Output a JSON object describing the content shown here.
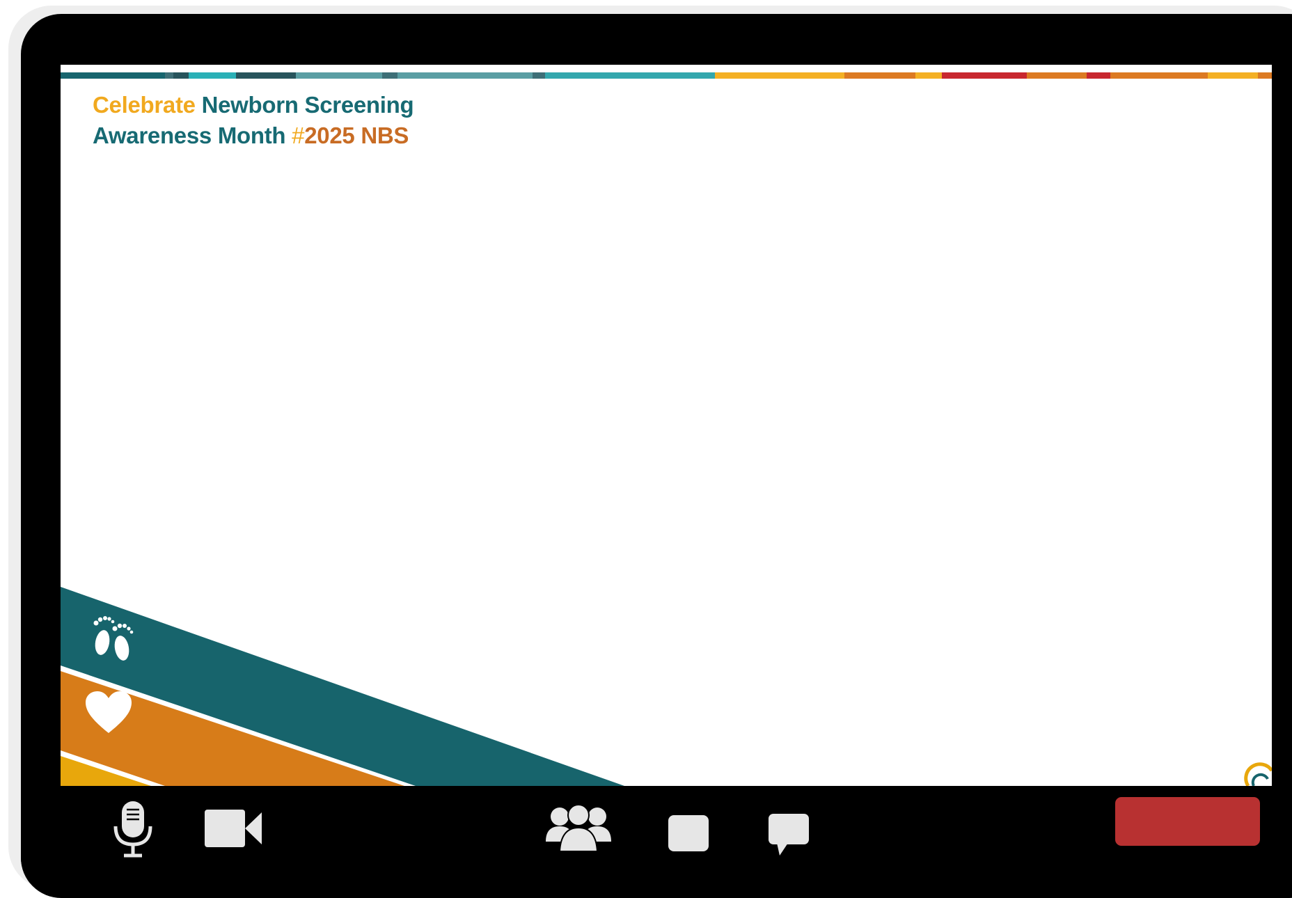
{
  "slide": {
    "headline": {
      "line1_part1": "Celebrate",
      "line1_part2": " Newborn Screening",
      "line2_part1": "Awareness Month ",
      "line2_hash": "#",
      "line2_part2": "2025 NBS"
    },
    "decorations": {
      "band_colors": [
        "#17646c",
        "#d77c19",
        "#e8a70c"
      ],
      "icons": [
        "footprints-icon",
        "heart-icon",
        "logo-mark"
      ]
    },
    "stripe_colors": [
      "#17656e",
      "#3e6f77",
      "#2ab0b6",
      "#27545c",
      "#33a7ad",
      "#5a9ea3",
      "#f4b024",
      "#dc7a22",
      "#c8272f"
    ]
  },
  "toolbar": {
    "left": [
      {
        "name": "microphone",
        "icon": "mic-icon"
      },
      {
        "name": "camera",
        "icon": "camera-icon"
      }
    ],
    "center": [
      {
        "name": "participants",
        "icon": "participants-icon"
      },
      {
        "name": "share",
        "icon": "share-icon"
      },
      {
        "name": "chat",
        "icon": "chat-icon"
      }
    ],
    "leave_button": {
      "label": "",
      "color": "#b83131"
    }
  }
}
